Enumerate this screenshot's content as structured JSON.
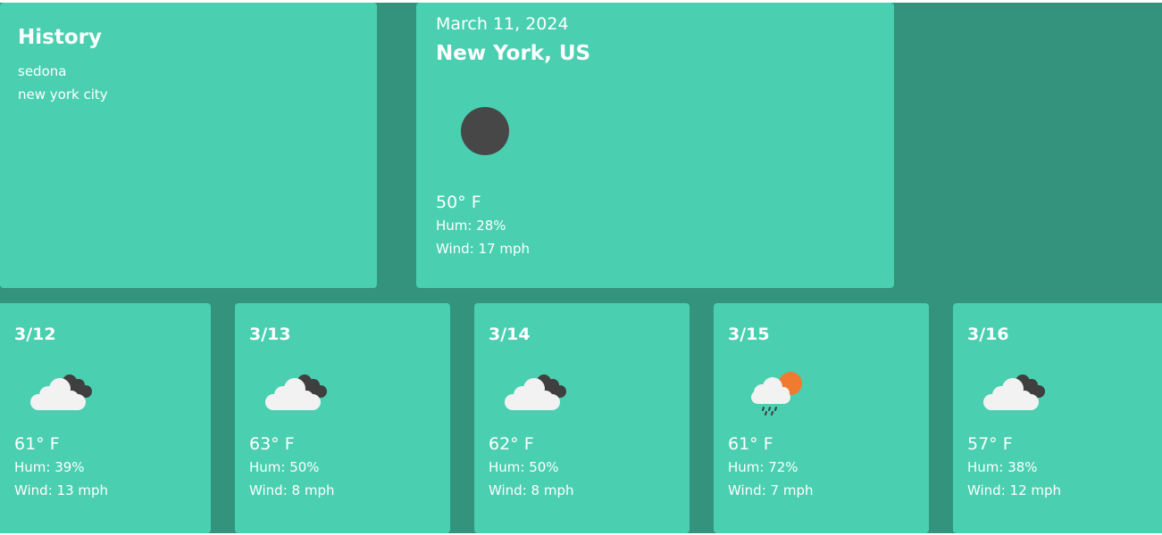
{
  "history": {
    "title": "History",
    "items": [
      "sedona",
      "new york city"
    ]
  },
  "current": {
    "date": "March 11, 2024",
    "city": "New York, US",
    "icon": "clear-night-moon-icon",
    "temp": "50° F",
    "humidity": "Hum: 28%",
    "wind": "Wind: 17 mph"
  },
  "forecast": [
    {
      "date": "3/12",
      "icon": "cloudy-icon",
      "temp": "61° F",
      "humidity": "Hum: 39%",
      "wind": "Wind: 13 mph"
    },
    {
      "date": "3/13",
      "icon": "cloudy-icon",
      "temp": "63° F",
      "humidity": "Hum: 50%",
      "wind": "Wind: 8 mph"
    },
    {
      "date": "3/14",
      "icon": "cloudy-icon",
      "temp": "62° F",
      "humidity": "Hum: 50%",
      "wind": "Wind: 8 mph"
    },
    {
      "date": "3/15",
      "icon": "rain-sun-icon",
      "temp": "61° F",
      "humidity": "Hum: 72%",
      "wind": "Wind: 7 mph"
    },
    {
      "date": "3/16",
      "icon": "cloudy-icon",
      "temp": "57° F",
      "humidity": "Hum: 38%",
      "wind": "Wind: 12 mph"
    }
  ],
  "colors": {
    "background": "#34937c",
    "card": "#4acfb0",
    "text": "#ffffff",
    "cloud_light": "#f2f2f2",
    "cloud_dark": "#3f3f3f",
    "sun": "#f07a30",
    "moon": "#474747"
  }
}
